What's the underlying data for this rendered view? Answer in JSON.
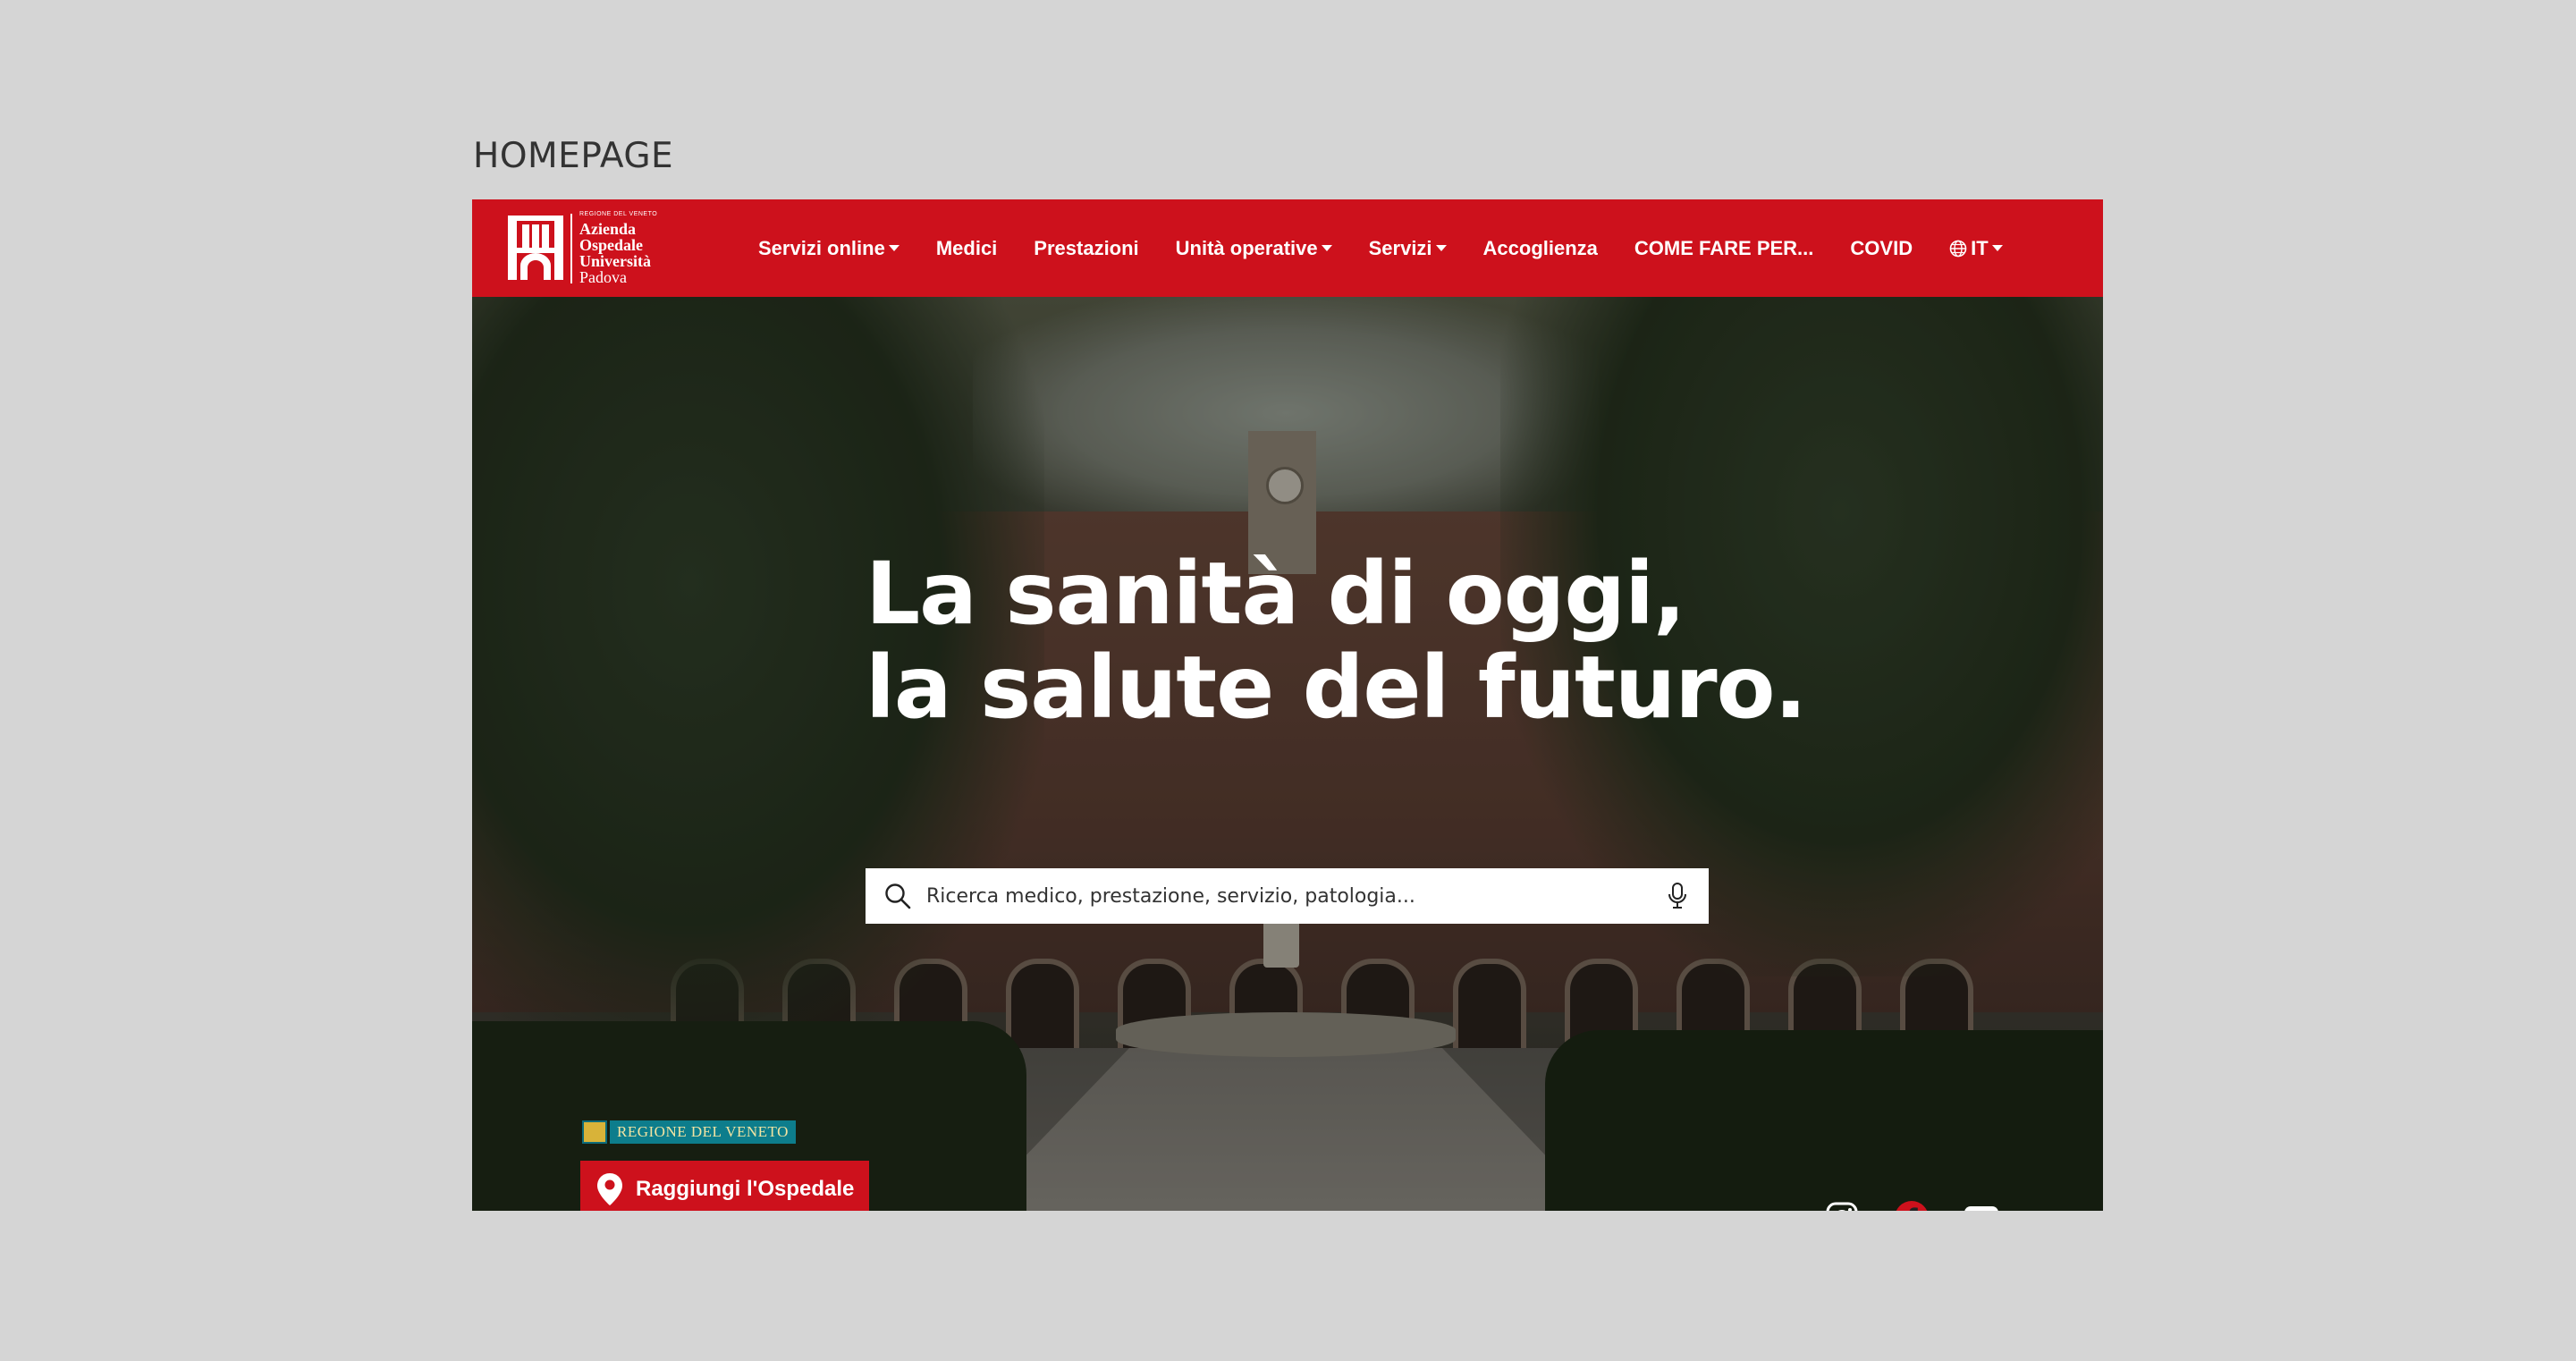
{
  "page_label": "HOMEPAGE",
  "brand": {
    "region_small": "REGIONE DEL VENETO",
    "line1": "Azienda",
    "line2": "Ospedale",
    "line3": "Università",
    "line4": "Padova",
    "color": "#cd111c"
  },
  "nav": {
    "items": [
      {
        "label": "Servizi online",
        "dropdown": true
      },
      {
        "label": "Medici",
        "dropdown": false
      },
      {
        "label": "Prestazioni",
        "dropdown": false
      },
      {
        "label": "Unità operative",
        "dropdown": true
      },
      {
        "label": "Servizi",
        "dropdown": true
      },
      {
        "label": "Accoglienza",
        "dropdown": false
      },
      {
        "label": "COME FARE PER...",
        "dropdown": false
      },
      {
        "label": "COVID",
        "dropdown": false
      }
    ],
    "language": "IT"
  },
  "hero": {
    "headline_line1": "La sanità di oggi,",
    "headline_line2": "la salute del futuro.",
    "search_placeholder": "Ricerca medico, prestazione, servizio, patologia...",
    "region_badge": "REGIONE DEL VENETO",
    "cta_label": "Raggiungi l'Ospedale"
  },
  "socials": [
    "instagram-icon",
    "facebook-icon",
    "youtube-icon"
  ]
}
